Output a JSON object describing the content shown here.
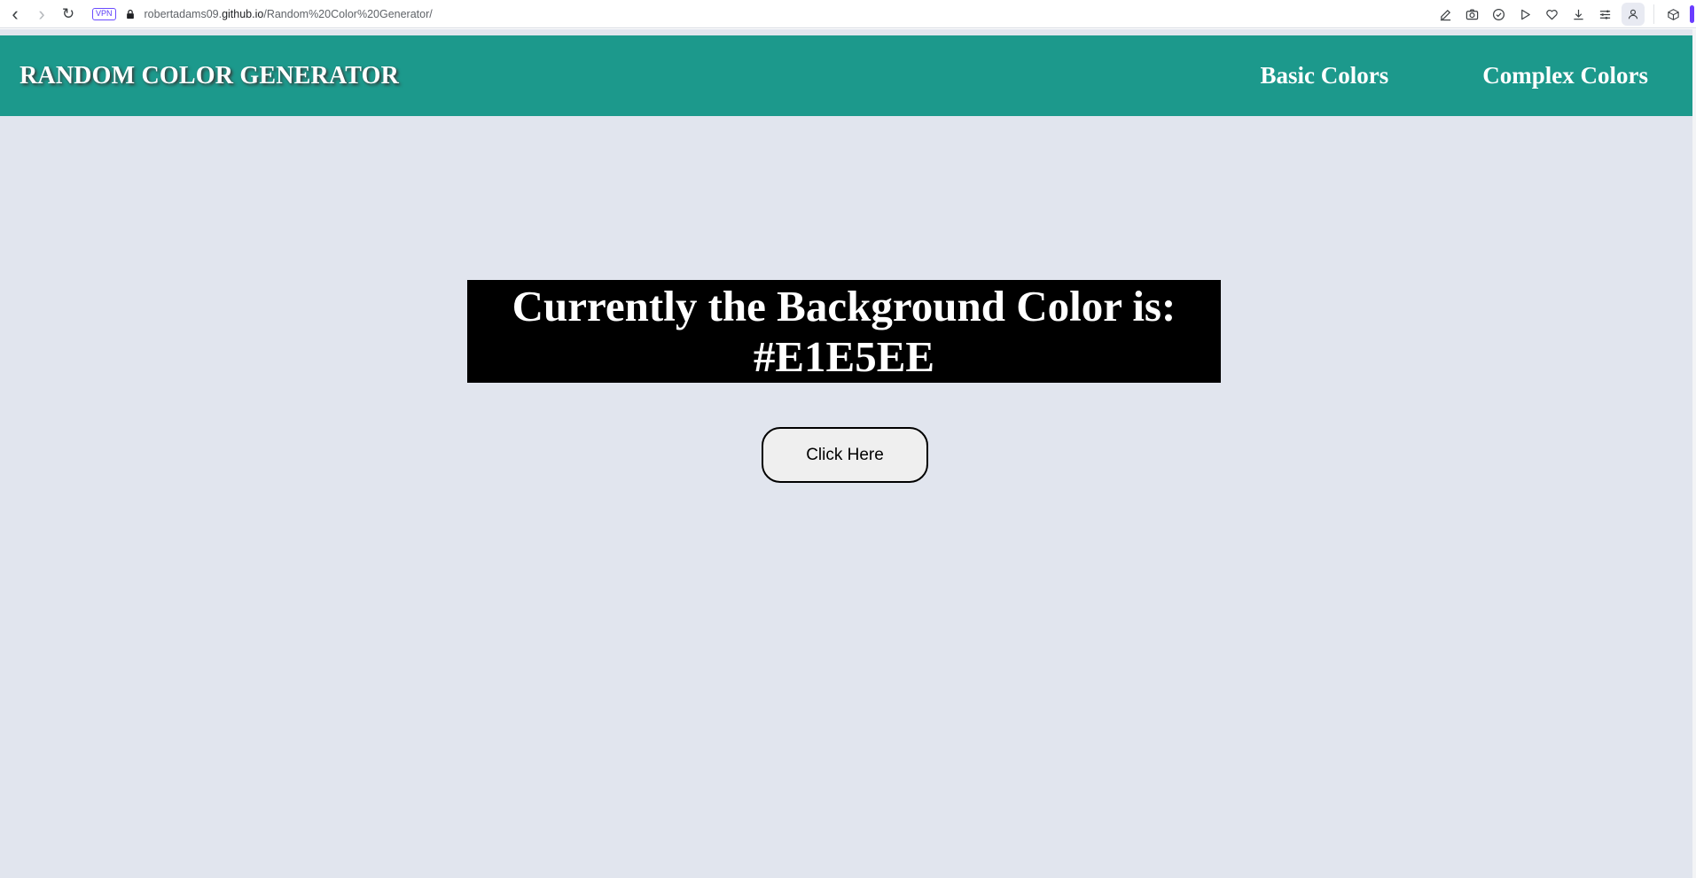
{
  "browser": {
    "back_glyph": "‹",
    "forward_glyph": "›",
    "reload_glyph": "↻",
    "vpn_label": "VPN",
    "url_prefix": "robertadams09.",
    "url_host": "github.io",
    "url_path": "/Random%20Color%20Generator/",
    "toolbar_icons": [
      "edit-icon",
      "camera-icon",
      "shield-icon",
      "play-icon",
      "heart-icon",
      "download-icon",
      "menu-icon",
      "profile-icon",
      "extensions-icon"
    ],
    "accent_color": "#6a3cff"
  },
  "header": {
    "brand": "RANDOM COLOR GENERATOR",
    "nav": {
      "basic": "Basic Colors",
      "complex": "Complex Colors"
    },
    "background_color": "#1c998c"
  },
  "main": {
    "background_color": "#E1E5EE",
    "status_line": "Currently the Background Color is:",
    "color_code": "#E1E5EE",
    "button_label": "Click Here"
  }
}
